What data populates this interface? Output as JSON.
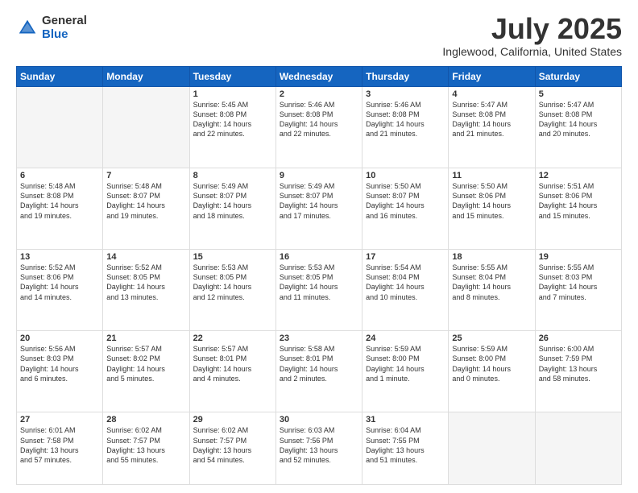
{
  "header": {
    "logo_general": "General",
    "logo_blue": "Blue",
    "month_title": "July 2025",
    "location": "Inglewood, California, United States"
  },
  "days_of_week": [
    "Sunday",
    "Monday",
    "Tuesday",
    "Wednesday",
    "Thursday",
    "Friday",
    "Saturday"
  ],
  "weeks": [
    [
      {
        "day": "",
        "info": ""
      },
      {
        "day": "",
        "info": ""
      },
      {
        "day": "1",
        "info": "Sunrise: 5:45 AM\nSunset: 8:08 PM\nDaylight: 14 hours\nand 22 minutes."
      },
      {
        "day": "2",
        "info": "Sunrise: 5:46 AM\nSunset: 8:08 PM\nDaylight: 14 hours\nand 22 minutes."
      },
      {
        "day": "3",
        "info": "Sunrise: 5:46 AM\nSunset: 8:08 PM\nDaylight: 14 hours\nand 21 minutes."
      },
      {
        "day": "4",
        "info": "Sunrise: 5:47 AM\nSunset: 8:08 PM\nDaylight: 14 hours\nand 21 minutes."
      },
      {
        "day": "5",
        "info": "Sunrise: 5:47 AM\nSunset: 8:08 PM\nDaylight: 14 hours\nand 20 minutes."
      }
    ],
    [
      {
        "day": "6",
        "info": "Sunrise: 5:48 AM\nSunset: 8:08 PM\nDaylight: 14 hours\nand 19 minutes."
      },
      {
        "day": "7",
        "info": "Sunrise: 5:48 AM\nSunset: 8:07 PM\nDaylight: 14 hours\nand 19 minutes."
      },
      {
        "day": "8",
        "info": "Sunrise: 5:49 AM\nSunset: 8:07 PM\nDaylight: 14 hours\nand 18 minutes."
      },
      {
        "day": "9",
        "info": "Sunrise: 5:49 AM\nSunset: 8:07 PM\nDaylight: 14 hours\nand 17 minutes."
      },
      {
        "day": "10",
        "info": "Sunrise: 5:50 AM\nSunset: 8:07 PM\nDaylight: 14 hours\nand 16 minutes."
      },
      {
        "day": "11",
        "info": "Sunrise: 5:50 AM\nSunset: 8:06 PM\nDaylight: 14 hours\nand 15 minutes."
      },
      {
        "day": "12",
        "info": "Sunrise: 5:51 AM\nSunset: 8:06 PM\nDaylight: 14 hours\nand 15 minutes."
      }
    ],
    [
      {
        "day": "13",
        "info": "Sunrise: 5:52 AM\nSunset: 8:06 PM\nDaylight: 14 hours\nand 14 minutes."
      },
      {
        "day": "14",
        "info": "Sunrise: 5:52 AM\nSunset: 8:05 PM\nDaylight: 14 hours\nand 13 minutes."
      },
      {
        "day": "15",
        "info": "Sunrise: 5:53 AM\nSunset: 8:05 PM\nDaylight: 14 hours\nand 12 minutes."
      },
      {
        "day": "16",
        "info": "Sunrise: 5:53 AM\nSunset: 8:05 PM\nDaylight: 14 hours\nand 11 minutes."
      },
      {
        "day": "17",
        "info": "Sunrise: 5:54 AM\nSunset: 8:04 PM\nDaylight: 14 hours\nand 10 minutes."
      },
      {
        "day": "18",
        "info": "Sunrise: 5:55 AM\nSunset: 8:04 PM\nDaylight: 14 hours\nand 8 minutes."
      },
      {
        "day": "19",
        "info": "Sunrise: 5:55 AM\nSunset: 8:03 PM\nDaylight: 14 hours\nand 7 minutes."
      }
    ],
    [
      {
        "day": "20",
        "info": "Sunrise: 5:56 AM\nSunset: 8:03 PM\nDaylight: 14 hours\nand 6 minutes."
      },
      {
        "day": "21",
        "info": "Sunrise: 5:57 AM\nSunset: 8:02 PM\nDaylight: 14 hours\nand 5 minutes."
      },
      {
        "day": "22",
        "info": "Sunrise: 5:57 AM\nSunset: 8:01 PM\nDaylight: 14 hours\nand 4 minutes."
      },
      {
        "day": "23",
        "info": "Sunrise: 5:58 AM\nSunset: 8:01 PM\nDaylight: 14 hours\nand 2 minutes."
      },
      {
        "day": "24",
        "info": "Sunrise: 5:59 AM\nSunset: 8:00 PM\nDaylight: 14 hours\nand 1 minute."
      },
      {
        "day": "25",
        "info": "Sunrise: 5:59 AM\nSunset: 8:00 PM\nDaylight: 14 hours\nand 0 minutes."
      },
      {
        "day": "26",
        "info": "Sunrise: 6:00 AM\nSunset: 7:59 PM\nDaylight: 13 hours\nand 58 minutes."
      }
    ],
    [
      {
        "day": "27",
        "info": "Sunrise: 6:01 AM\nSunset: 7:58 PM\nDaylight: 13 hours\nand 57 minutes."
      },
      {
        "day": "28",
        "info": "Sunrise: 6:02 AM\nSunset: 7:57 PM\nDaylight: 13 hours\nand 55 minutes."
      },
      {
        "day": "29",
        "info": "Sunrise: 6:02 AM\nSunset: 7:57 PM\nDaylight: 13 hours\nand 54 minutes."
      },
      {
        "day": "30",
        "info": "Sunrise: 6:03 AM\nSunset: 7:56 PM\nDaylight: 13 hours\nand 52 minutes."
      },
      {
        "day": "31",
        "info": "Sunrise: 6:04 AM\nSunset: 7:55 PM\nDaylight: 13 hours\nand 51 minutes."
      },
      {
        "day": "",
        "info": ""
      },
      {
        "day": "",
        "info": ""
      }
    ]
  ]
}
